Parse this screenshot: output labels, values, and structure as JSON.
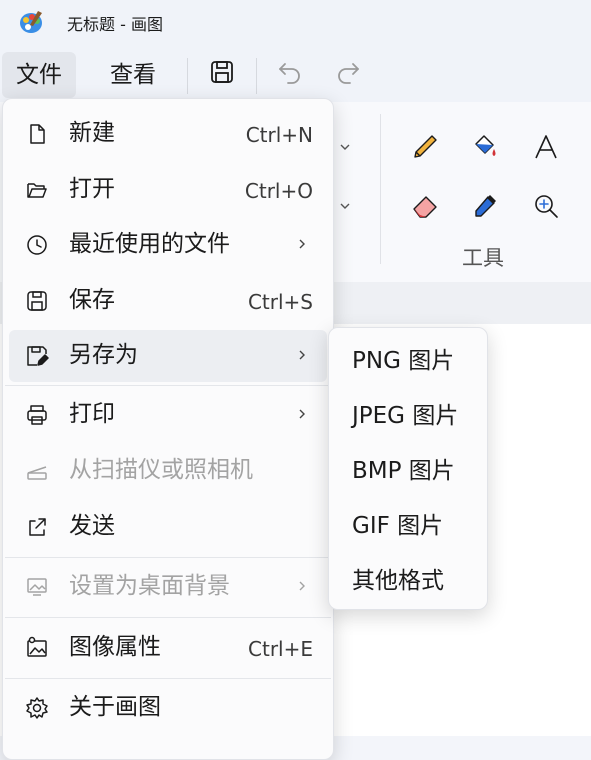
{
  "window": {
    "title": "无标题 - 画图",
    "icon": "paint-app-icon"
  },
  "menubar": {
    "file_label": "文件",
    "view_label": "查看",
    "save_icon": "save-icon",
    "undo_icon": "undo-icon",
    "redo_icon": "redo-icon"
  },
  "ribbon": {
    "tools_group_label": "工具",
    "tools": [
      "pencil-icon",
      "fill-bucket-icon",
      "text-icon",
      "eraser-icon",
      "color-picker-icon",
      "magnifier-icon"
    ]
  },
  "file_menu": {
    "items": [
      {
        "label": "新建",
        "shortcut": "Ctrl+N",
        "icon": "new-file-icon"
      },
      {
        "label": "打开",
        "shortcut": "Ctrl+O",
        "icon": "open-folder-icon"
      },
      {
        "label": "最近使用的文件",
        "icon": "clock-icon",
        "submenu": true
      },
      {
        "label": "保存",
        "shortcut": "Ctrl+S",
        "icon": "save-icon"
      },
      {
        "label": "另存为",
        "icon": "save-as-icon",
        "submenu": true,
        "highlighted": true
      },
      {
        "label": "打印",
        "icon": "printer-icon",
        "submenu": true
      },
      {
        "label": "从扫描仪或照相机",
        "icon": "scanner-icon",
        "disabled": true
      },
      {
        "label": "发送",
        "icon": "share-icon"
      },
      {
        "label": "设置为桌面背景",
        "icon": "wallpaper-icon",
        "submenu": true,
        "disabled": true
      },
      {
        "label": "图像属性",
        "shortcut": "Ctrl+E",
        "icon": "image-properties-icon"
      },
      {
        "label": "关于画图",
        "icon": "gear-icon"
      }
    ]
  },
  "save_as_menu": {
    "items": [
      {
        "label": "PNG 图片"
      },
      {
        "label": "JPEG 图片"
      },
      {
        "label": "BMP 图片"
      },
      {
        "label": "GIF 图片"
      },
      {
        "label": "其他格式"
      }
    ]
  },
  "colors": {
    "accent": "#0067c0",
    "highlight": "#eceef2",
    "disabled_text": "#a3a3a3",
    "paint_red": "#d13438"
  }
}
